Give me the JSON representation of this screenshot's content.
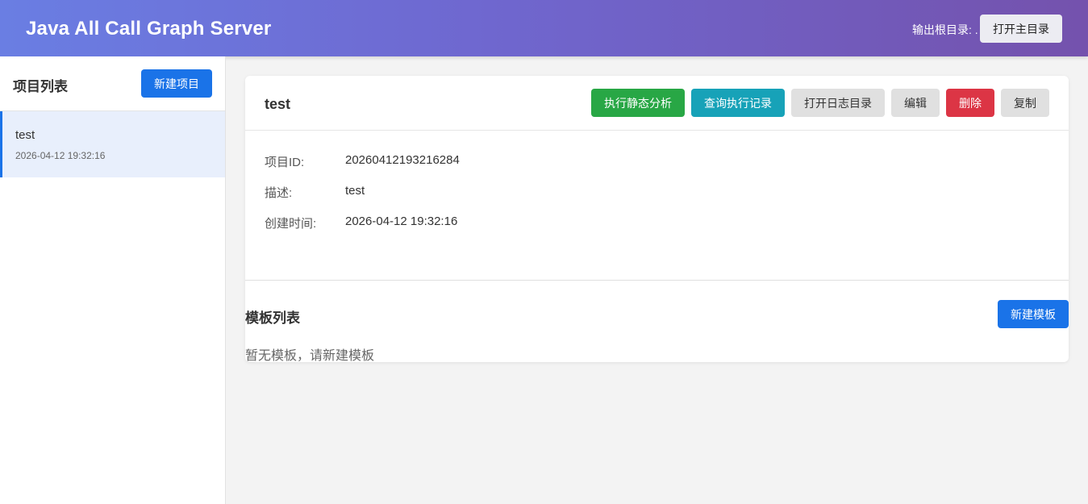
{
  "header": {
    "title": "Java All Call Graph Server",
    "output_root_label": "输出根目录: .",
    "open_main_dir_label": "打开主目录"
  },
  "sidebar": {
    "title": "项目列表",
    "new_project_label": "新建项目",
    "projects": [
      {
        "name": "test",
        "created": "2026-04-12 19:32:16",
        "selected": true
      }
    ]
  },
  "project": {
    "title": "test",
    "actions": {
      "analyze": "执行静态分析",
      "query": "查询执行记录",
      "open_log": "打开日志目录",
      "edit": "编辑",
      "delete": "删除",
      "copy": "复制"
    },
    "fields": [
      {
        "label": "项目ID:",
        "value": "20260412193216284"
      },
      {
        "label": "描述:",
        "value": "test"
      },
      {
        "label": "创建时间:",
        "value": "2026-04-12 19:32:16"
      }
    ]
  },
  "templates": {
    "title": "模板列表",
    "new_template_label": "新建模板",
    "empty_message": "暂无模板，请新建模板"
  },
  "colors": {
    "header_gradient_start": "#6a7ee3",
    "header_gradient_end": "#7452ad",
    "primary": "#1a73e8",
    "success": "#28a745",
    "info": "#17a2b8",
    "danger": "#dc3545",
    "neutral": "#e0e0e0"
  }
}
